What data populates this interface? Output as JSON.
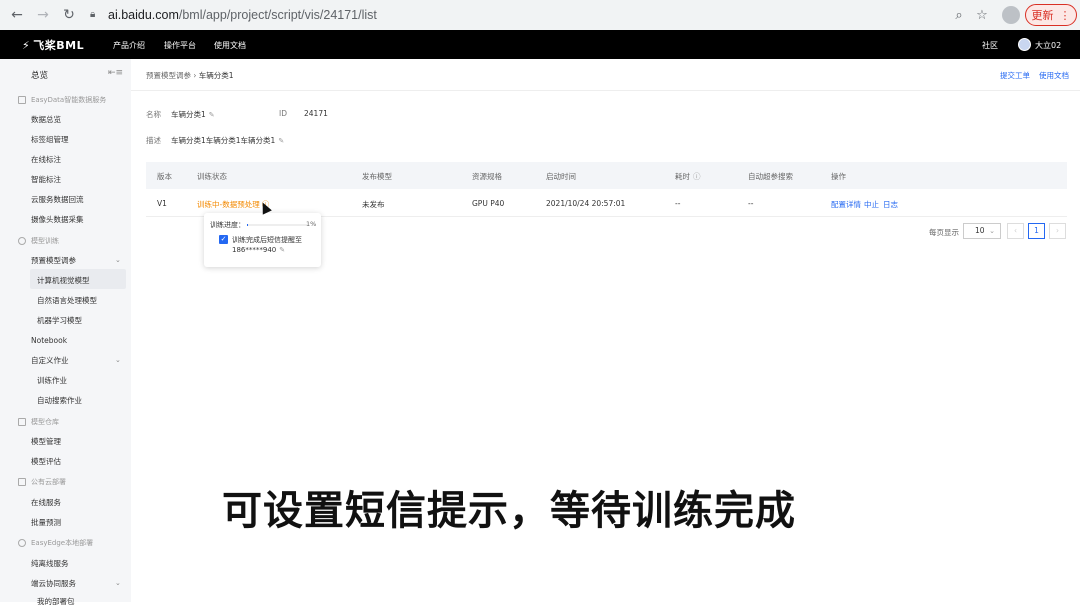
{
  "browser": {
    "url_host": "ai.baidu.com",
    "url_path": "/bml/app/project/script/vis/24171/list",
    "update_label": "更新"
  },
  "topbar": {
    "brand": "飞桨BML",
    "nav": [
      "产品介绍",
      "操作平台",
      "使用文档"
    ],
    "community": "社区",
    "username": "大立02"
  },
  "sidebar": {
    "overview": "总览",
    "groups": [
      {
        "label": "EasyData智能数据服务",
        "items": [
          "数据总览",
          "标签组管理",
          "在线标注",
          "智能标注",
          "云服务数据回流",
          "摄像头数据采集"
        ]
      },
      {
        "label": "模型训练",
        "items": [
          "预置模型调参",
          "计算机视觉模型",
          "自然语言处理模型",
          "机器学习模型",
          "Notebook",
          "自定义作业",
          "训练作业",
          "自动搜索作业"
        ]
      },
      {
        "label": "模型仓库",
        "items": [
          "模型管理",
          "模型评估"
        ]
      },
      {
        "label": "公有云部署",
        "items": [
          "在线服务",
          "批量预测"
        ]
      },
      {
        "label": "EasyEdge本地部署",
        "items": [
          "纯离线服务",
          "端云协同服务",
          "我的部署包"
        ]
      }
    ]
  },
  "breadcrumb": {
    "parent": "预置模型调参",
    "current": "车辆分类1"
  },
  "top_links": {
    "ticket": "提交工单",
    "docs": "使用文档"
  },
  "info": {
    "name_label": "名称",
    "name_value": "车辆分类1",
    "id_label": "ID",
    "id_value": "24171",
    "desc_label": "描述",
    "desc_value": "车辆分类1车辆分类1车辆分类1"
  },
  "table": {
    "headers": [
      "版本",
      "训练状态",
      "发布模型",
      "资源规格",
      "启动时间",
      "耗时",
      "自动超参搜索",
      "操作"
    ],
    "row": {
      "version": "V1",
      "status": "训练中-数据预处理",
      "publish": "未发布",
      "resource": "GPU P40",
      "start_time": "2021/10/24 20:57:01",
      "duration": "--",
      "auto_search": "--",
      "actions": [
        "配置详情",
        "中止",
        "日志"
      ]
    }
  },
  "pagination": {
    "label": "每页显示",
    "page_size": "10",
    "current_page": "1"
  },
  "popover": {
    "progress_label": "训练进度：",
    "progress_percent": "1%",
    "progress_value": 0.01,
    "notify_line1": "训练完成后短信提醒至",
    "notify_line2": "186*****940"
  },
  "caption": "可设置短信提示，等待训练完成",
  "colors": {
    "accent": "#2468f2",
    "status_orange": "#f38900"
  }
}
